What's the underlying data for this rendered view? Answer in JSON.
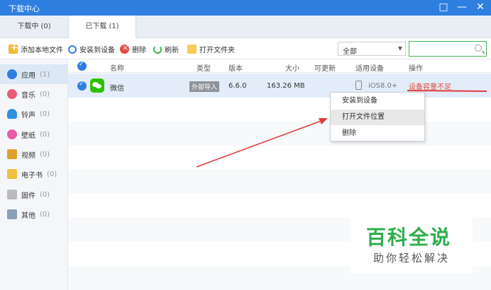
{
  "window": {
    "title": "下载中心",
    "controls": [
      "□",
      "—",
      "✕"
    ]
  },
  "tabs": [
    {
      "label": "下载中 (0)"
    },
    {
      "label": "已下载 (1)"
    }
  ],
  "toolbar": {
    "add_local": "添加本地文件",
    "install": "安装到设备",
    "delete": "删除",
    "refresh": "刷新",
    "open_folder": "打开文件夹",
    "filter_value": "全部",
    "search_placeholder": ""
  },
  "sidebar": {
    "items": [
      {
        "label": "应用",
        "count": "(1)",
        "icon": "app-store-icon",
        "color": "#2f7fe0"
      },
      {
        "label": "音乐",
        "count": "(0)",
        "icon": "music-icon",
        "color": "#e85c78"
      },
      {
        "label": "铃声",
        "count": "(0)",
        "icon": "bell-icon",
        "color": "#2f8fe0"
      },
      {
        "label": "壁纸",
        "count": "(0)",
        "icon": "wallpaper-icon",
        "color": "#e85ca8"
      },
      {
        "label": "视频",
        "count": "(0)",
        "icon": "video-icon",
        "color": "#e0a030"
      },
      {
        "label": "电子书",
        "count": "(0)",
        "icon": "ebook-icon",
        "color": "#f0c040"
      },
      {
        "label": "固件",
        "count": "(0)",
        "icon": "firmware-icon",
        "color": "#bbbbbb"
      },
      {
        "label": "其他",
        "count": "(0)",
        "icon": "other-icon",
        "color": "#8aa0b8"
      }
    ]
  },
  "table": {
    "headers": [
      "名称",
      "类型",
      "版本",
      "大小",
      "可更新",
      "适用设备",
      "操作"
    ],
    "rows": [
      {
        "name": "微信",
        "type": "外部导入",
        "version": "6.6.0",
        "size": "163.26 MB",
        "updatable": "",
        "device": "iOS8.0+",
        "action": "设备容量不足"
      }
    ]
  },
  "context_menu": {
    "items": [
      "安装到设备",
      "打开文件位置",
      "删除"
    ]
  },
  "watermark": {
    "title": "百科全说",
    "subtitle": "助你轻松解决"
  }
}
